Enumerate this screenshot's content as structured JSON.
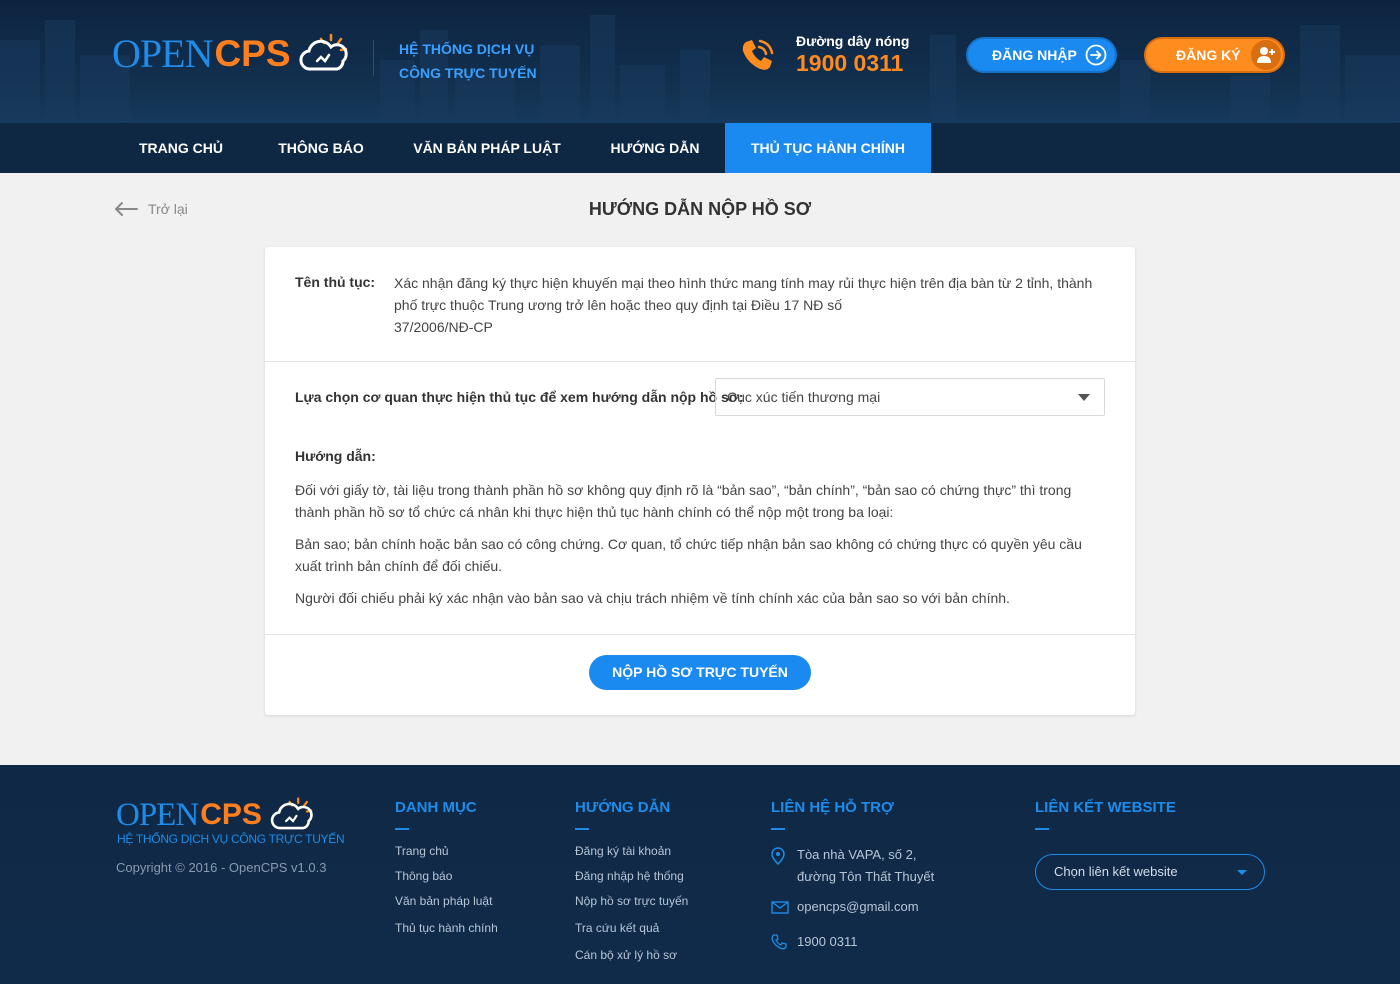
{
  "brand": {
    "logo_open": "OPEN",
    "logo_cps": "CPS",
    "slogan_line1": "HỆ THỐNG DỊCH VỤ",
    "slogan_line2": "CÔNG TRỰC TUYẾN",
    "accent_blue": "#1a8af0",
    "accent_orange": "#ff8c1f"
  },
  "header": {
    "hotline_label": "Đường dây nóng",
    "hotline_number": "1900 0311",
    "login_label": "ĐĂNG NHẬP",
    "register_label": "ĐĂNG KÝ"
  },
  "nav": {
    "items": [
      {
        "label": "TRANG CHỦ"
      },
      {
        "label": "THÔNG BÁO"
      },
      {
        "label": "VĂN BẢN PHÁP LUẬT"
      },
      {
        "label": "HƯỚNG DẪN"
      },
      {
        "label": "THỦ TỤC HÀNH CHÍNH",
        "active": true
      }
    ]
  },
  "main": {
    "back_label": "Trở lại",
    "title": "HƯỚNG DẪN NỘP HỒ SƠ",
    "procedure_label": "Tên thủ tục:",
    "procedure_value_line1": "Xác nhận đăng ký thực hiện khuyến mại theo hình thức mang tính may rủi thực hiện trên địa bàn từ 2 tỉnh, thành phố trực thuộc Trung ương trở lên hoặc theo quy định tại Điều 17 NĐ số",
    "procedure_value_line2": "37/2006/NĐ-CP",
    "agency_label": "Lựa chọn cơ quan thực hiện thủ tục để xem hướng dẫn nộp hồ sơ:",
    "agency_selected": "Cục xúc tiến thương mại",
    "guide_title": "Hướng dẫn:",
    "guide_paragraphs": [
      "Đối với giấy tờ, tài liệu trong thành phần hồ sơ không quy định rõ là “bản sao”, “bản chính”, “bản sao có chứng thực” thì trong thành phần hồ sơ tổ chức cá nhân khi thực hiện thủ tục hành chính có thể nộp một trong ba loại:",
      "Bản sao; bản chính hoặc bản sao có công chứng. Cơ quan, tổ chức tiếp nhận bản sao không có chứng thực có quyền yêu cầu xuất trình bản chính để đối chiếu.",
      "Người đối chiếu phải ký xác nhận vào bản sao và chịu trách nhiệm về tính chính xác của bản sao so với bản chính."
    ],
    "submit_label": "NỘP HỒ SƠ TRỰC TUYẾN"
  },
  "footer": {
    "slogan": "HỆ THỐNG DỊCH VỤ CÔNG TRỰC TUYẾN",
    "copyright": "Copyright © 2016 - OpenCPS v1.0.3",
    "categories": {
      "title": "DANH MỤC",
      "links": [
        "Trang chủ",
        "Thông báo",
        "Văn bản pháp luật",
        "Thủ tục hành chính"
      ]
    },
    "guides": {
      "title": "HƯỚNG DẪN",
      "links": [
        "Đăng ký tài khoản",
        "Đăng nhập hệ thống",
        "Nộp hồ sơ trực tuyến",
        "Tra cứu kết quả",
        "Cán bộ xử lý hồ sơ"
      ]
    },
    "contact": {
      "title": "LIÊN HỆ HỖ TRỢ",
      "address_line1": "Tòa nhà VAPA, số 2,",
      "address_line2": "đường Tôn Thất Thuyết",
      "email": "opencps@gmail.com",
      "phone": "1900 0311"
    },
    "links": {
      "title": "LIÊN KẾT WEBSITE",
      "select_placeholder": "Chọn liên kết website"
    }
  }
}
